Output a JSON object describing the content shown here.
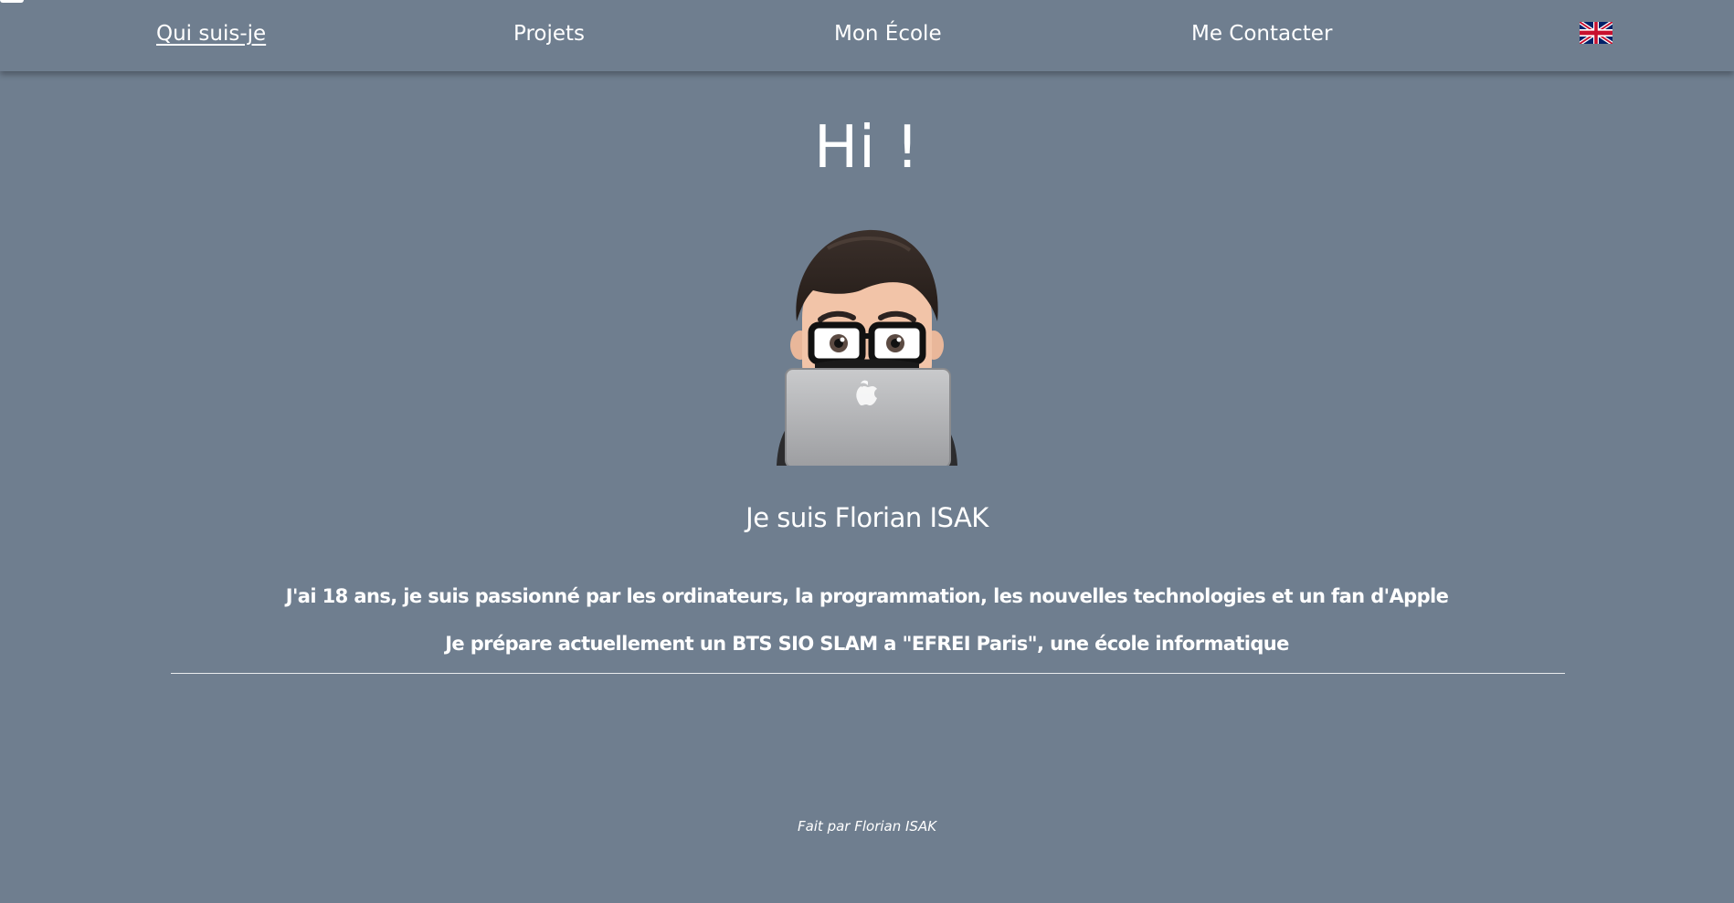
{
  "nav": {
    "items": [
      {
        "label": "Qui suis-je",
        "active": true
      },
      {
        "label": "Projets",
        "active": false
      },
      {
        "label": "Mon École",
        "active": false
      },
      {
        "label": "Me Contacter",
        "active": false
      }
    ],
    "language_icon": "uk-flag-icon"
  },
  "hero": {
    "title": "Hi !",
    "avatar_icon": "memoji-laptop-avatar"
  },
  "about": {
    "name_line": "Je suis Florian ISAK",
    "paragraphs": [
      "J'ai 18 ans, je suis passionné par les ordinateurs, la programmation, les nouvelles technologies et un fan d'Apple",
      "Je prépare actuellement un BTS SIO SLAM a \"EFREI Paris\", une école informatique"
    ]
  },
  "footer": {
    "credit": "Fait par Florian ISAK"
  },
  "colors": {
    "background": "#6f7e8f",
    "text": "#ffffff"
  }
}
